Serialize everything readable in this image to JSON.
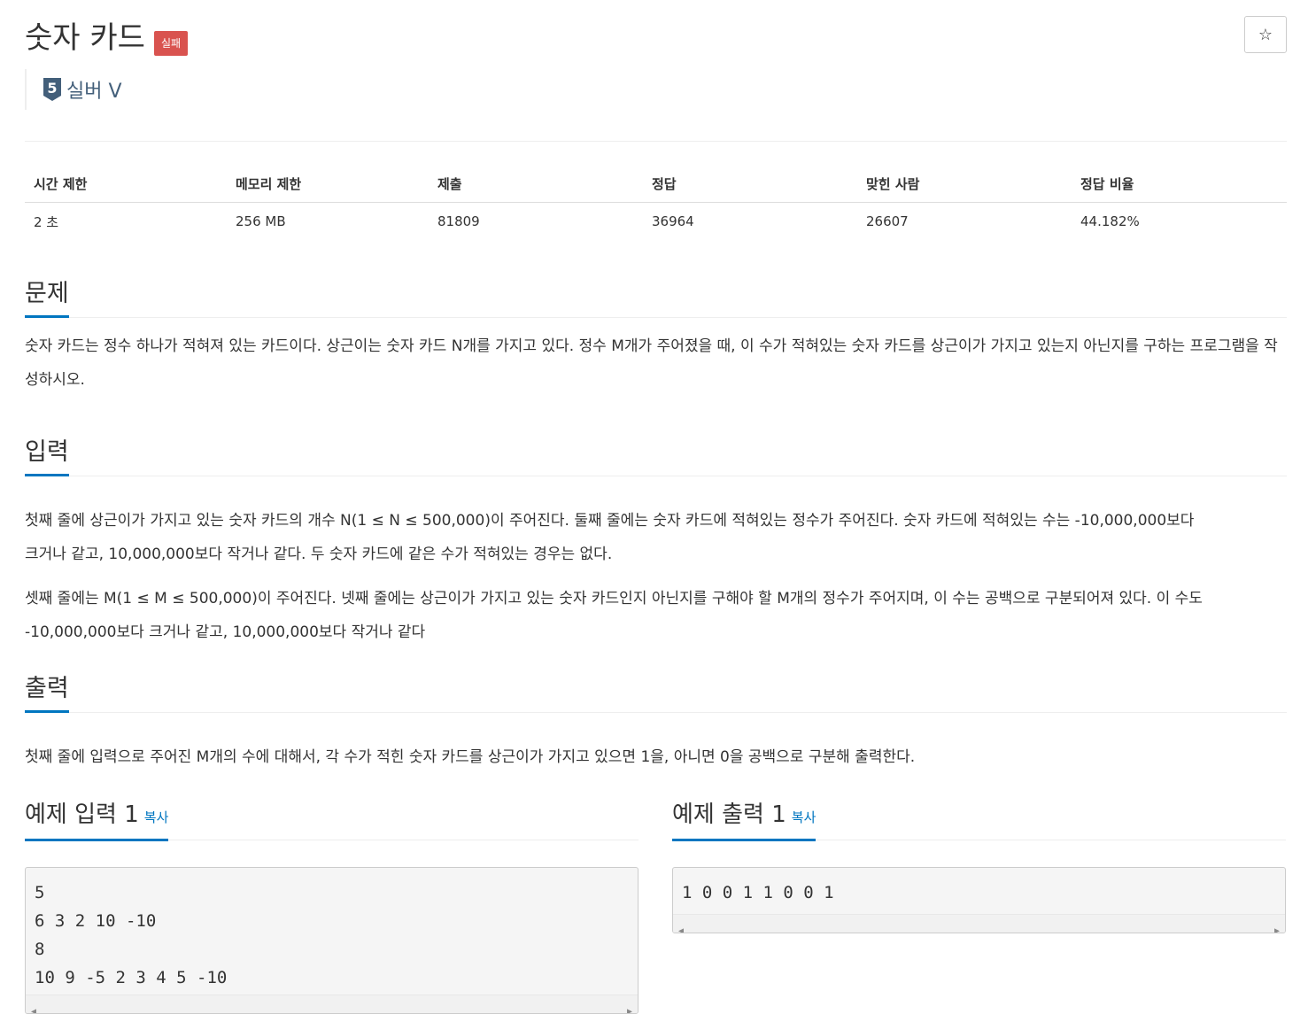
{
  "problem": {
    "title": "숫자 카드",
    "status_badge": "실패",
    "star_icon": "☆",
    "tier": {
      "number": "5",
      "label": "실버 V",
      "color": "#435f7a"
    }
  },
  "info": {
    "headers": [
      "시간 제한",
      "메모리 제한",
      "제출",
      "정답",
      "맞힌 사람",
      "정답 비율"
    ],
    "values": [
      "2 초",
      "256 MB",
      "81809",
      "36964",
      "26607",
      "44.182%"
    ]
  },
  "sections": {
    "problem": {
      "title": "문제",
      "paragraphs": [
        "숫자 카드는 정수 하나가 적혀져 있는 카드이다. 상근이는 숫자 카드 N개를 가지고 있다. 정수 M개가 주어졌을 때, 이 수가 적혀있는 숫자 카드를 상근이가 가지고 있는지 아닌지를 구하는 프로그램을 작성하시오."
      ]
    },
    "input": {
      "title": "입력",
      "paragraphs": [
        "첫째 줄에 상근이가 가지고 있는 숫자 카드의 개수 N(1 ≤ N ≤ 500,000)이 주어진다. 둘째 줄에는 숫자 카드에 적혀있는 정수가 주어진다. 숫자 카드에 적혀있는 수는 -10,000,000보다 크거나 같고, 10,000,000보다 작거나 같다. 두 숫자 카드에 같은 수가 적혀있는 경우는 없다.",
        "셋째 줄에는 M(1 ≤ M ≤ 500,000)이 주어진다. 넷째 줄에는 상근이가 가지고 있는 숫자 카드인지 아닌지를 구해야 할 M개의 정수가 주어지며, 이 수는 공백으로 구분되어져 있다. 이 수도 -10,000,000보다 크거나 같고, 10,000,000보다 작거나 같다"
      ]
    },
    "output": {
      "title": "출력",
      "paragraphs": [
        "첫째 줄에 입력으로 주어진 M개의 수에 대해서, 각 수가 적힌 숫자 카드를 상근이가 가지고 있으면 1을, 아니면 0을 공백으로 구분해 출력한다."
      ]
    }
  },
  "samples": {
    "copy_label": "복사",
    "input": {
      "title": "예제 입력 1",
      "lines": [
        "5",
        "6 3 2 10 -10",
        "8",
        "10 9 -5 2 3 4 5 -10"
      ]
    },
    "output": {
      "title": "예제 출력 1",
      "lines": [
        "1 0 0 1 1 0 0 1"
      ]
    }
  },
  "colors": {
    "accent": "#0076c0",
    "badge_fail": "#d9534f"
  }
}
